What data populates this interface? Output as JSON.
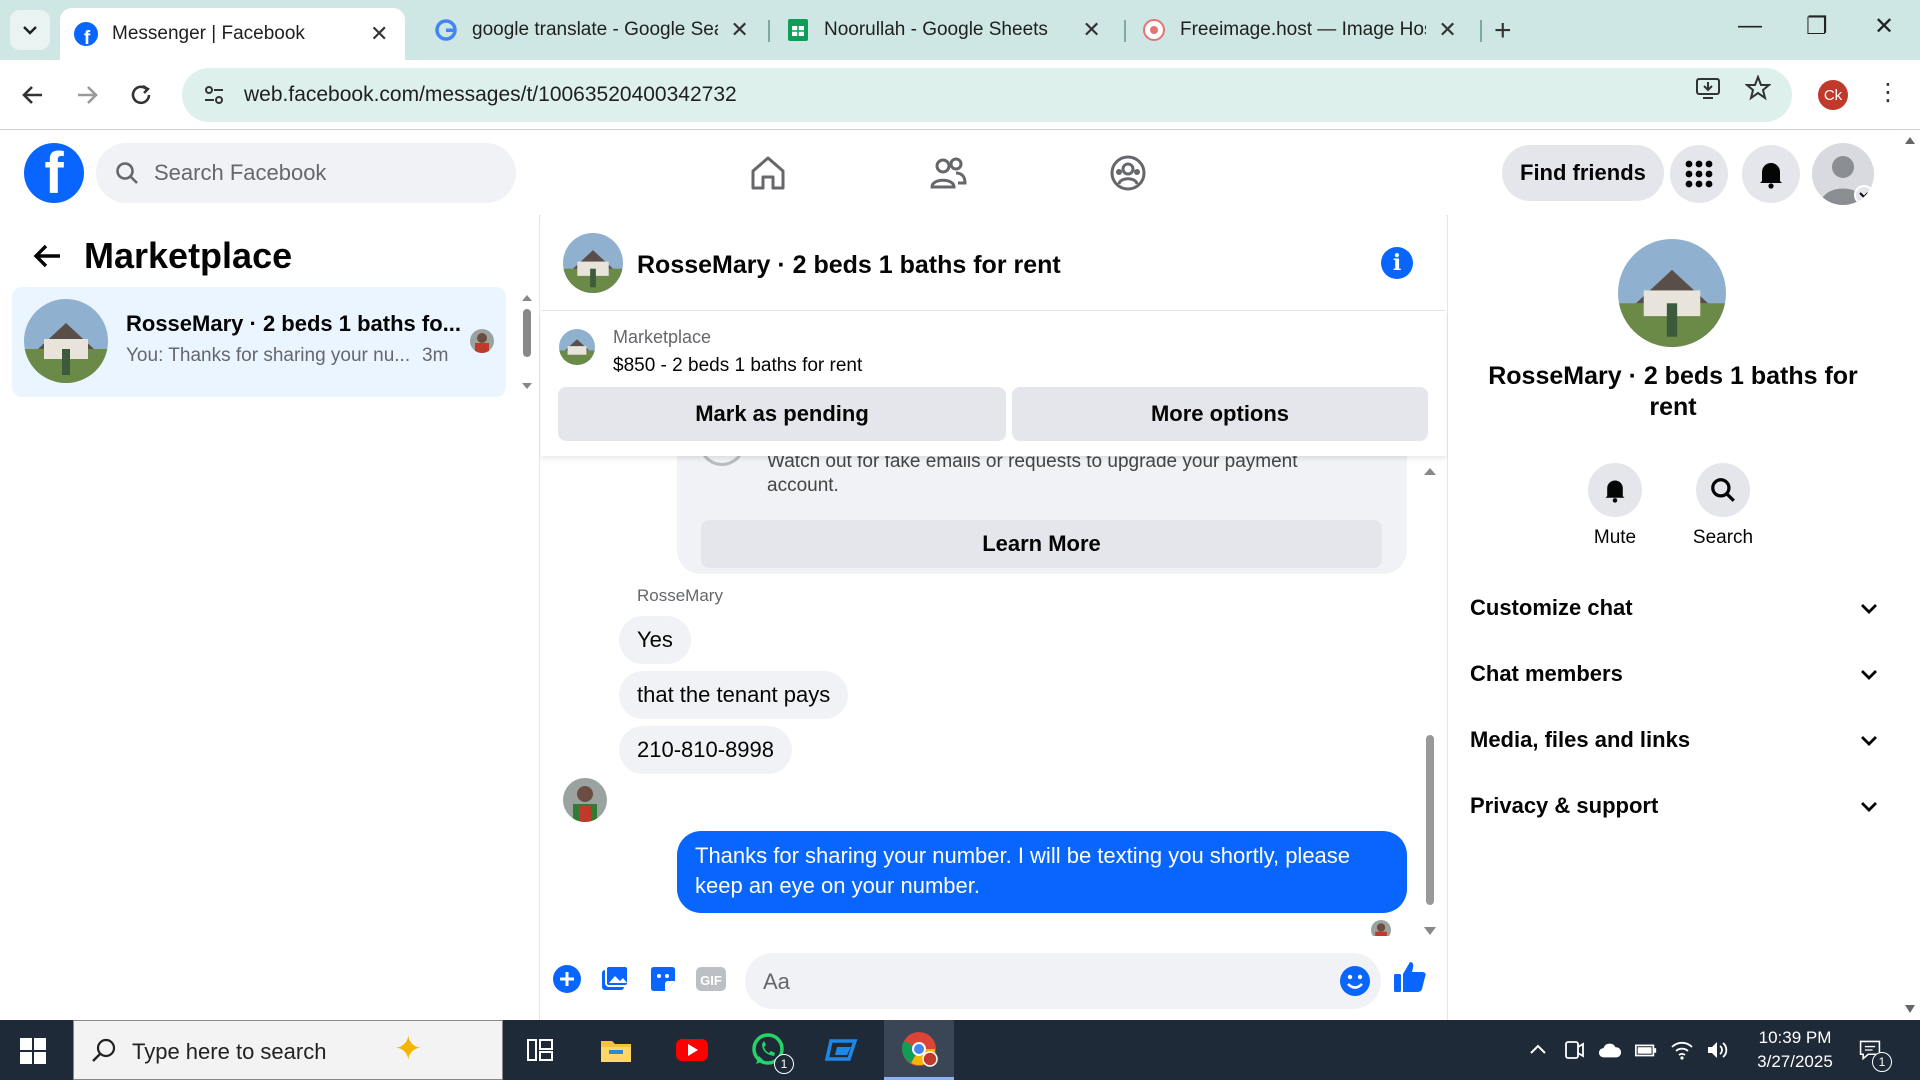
{
  "browser": {
    "tabs": [
      {
        "title": "Messenger | Facebook",
        "favicon": "facebook-icon",
        "active": true
      },
      {
        "title": "google translate - Google Search",
        "favicon": "google-icon",
        "active": false
      },
      {
        "title": "Noorullah - Google Sheets",
        "favicon": "sheets-icon",
        "active": false
      },
      {
        "title": "Freeimage.host — Image Hosting",
        "favicon": "freeimage-icon",
        "active": false
      }
    ],
    "url": "web.facebook.com/messages/t/10063520400342732",
    "profile_initials": "Ck",
    "tab_close_glyph": "✕",
    "new_tab_glyph": "+",
    "minimize_glyph": "—",
    "restore_glyph": "❐",
    "close_glyph": "✕",
    "menu_glyph": "⋮"
  },
  "facebook": {
    "logo_letter": "f",
    "search_placeholder": "Search Facebook",
    "find_friends": "Find friends",
    "brand_color": "#0866ff"
  },
  "sidebar": {
    "title": "Marketplace",
    "conversations": [
      {
        "name": "RosseMary · 2 beds 1 baths fo...",
        "preview": "You: Thanks for sharing your nu...",
        "time": "3m"
      }
    ]
  },
  "chat": {
    "title": "RosseMary · 2 beds 1 baths for rent",
    "listing": {
      "label": "Marketplace",
      "price": "$850 - 2 beds 1 baths for rent",
      "mark_pending": "Mark as pending",
      "more_options": "More options"
    },
    "warning_text": "Watch out for fake emails or requests to upgrade your payment account.",
    "learn_more": "Learn More",
    "sender_name": "RosseMary",
    "incoming": [
      "Yes",
      "that the tenant pays",
      "210-810-8998"
    ],
    "outgoing": "Thanks for sharing your number. I will be texting you shortly, please keep an eye on your number.",
    "composer_placeholder": "Aa"
  },
  "details": {
    "title": "RosseMary · 2 beds 1 baths for rent",
    "actions": [
      {
        "label": "Mute",
        "icon": "bell-icon"
      },
      {
        "label": "Search",
        "icon": "search-icon"
      }
    ],
    "sections": [
      "Customize chat",
      "Chat members",
      "Media, files and links",
      "Privacy & support"
    ]
  },
  "taskbar": {
    "search_placeholder": "Type here to search",
    "time": "10:39 PM",
    "date": "3/27/2025",
    "whatsapp_badge": "1",
    "notification_badge": "1"
  }
}
